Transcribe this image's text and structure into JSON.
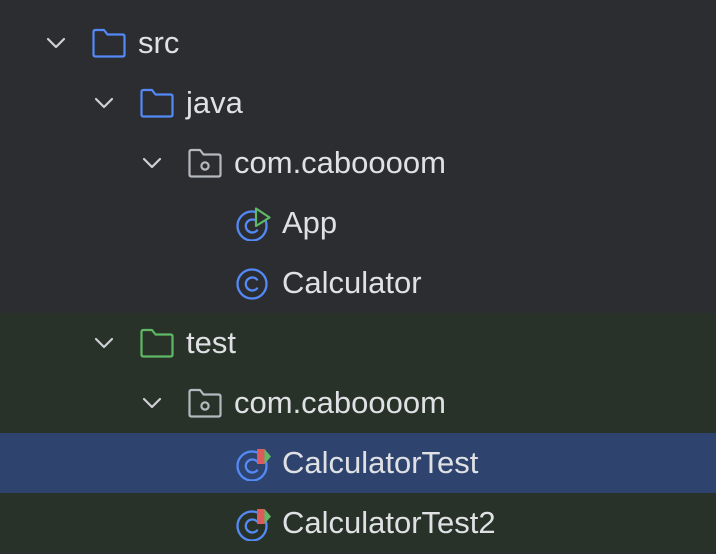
{
  "project_tree": {
    "src": {
      "label": "src",
      "icon": "folder-icon"
    },
    "java": {
      "label": "java",
      "icon": "source-folder-icon"
    },
    "main_package": {
      "label": "com.caboooom",
      "icon": "package-icon"
    },
    "app": {
      "label": "App",
      "icon": "runnable-class-icon"
    },
    "calculator": {
      "label": "Calculator",
      "icon": "class-icon"
    },
    "test": {
      "label": "test",
      "icon": "test-folder-icon"
    },
    "test_package": {
      "label": "com.caboooom",
      "icon": "package-icon"
    },
    "calculator_test": {
      "label": "CalculatorTest",
      "icon": "test-class-icon",
      "selected": true
    },
    "calculator_test2": {
      "label": "CalculatorTest2",
      "icon": "test-class-icon"
    }
  },
  "colors": {
    "background": "#2b2d30",
    "test_zone": "#283228",
    "selection": "#2e436e",
    "folder_blue": "#548af7",
    "test_folder_green": "#5fb865",
    "class_blue": "#548af7",
    "run_green": "#5fb865",
    "test_red": "#db5c5c",
    "text": "#dfe1e5",
    "chevron": "#ced0d6"
  }
}
